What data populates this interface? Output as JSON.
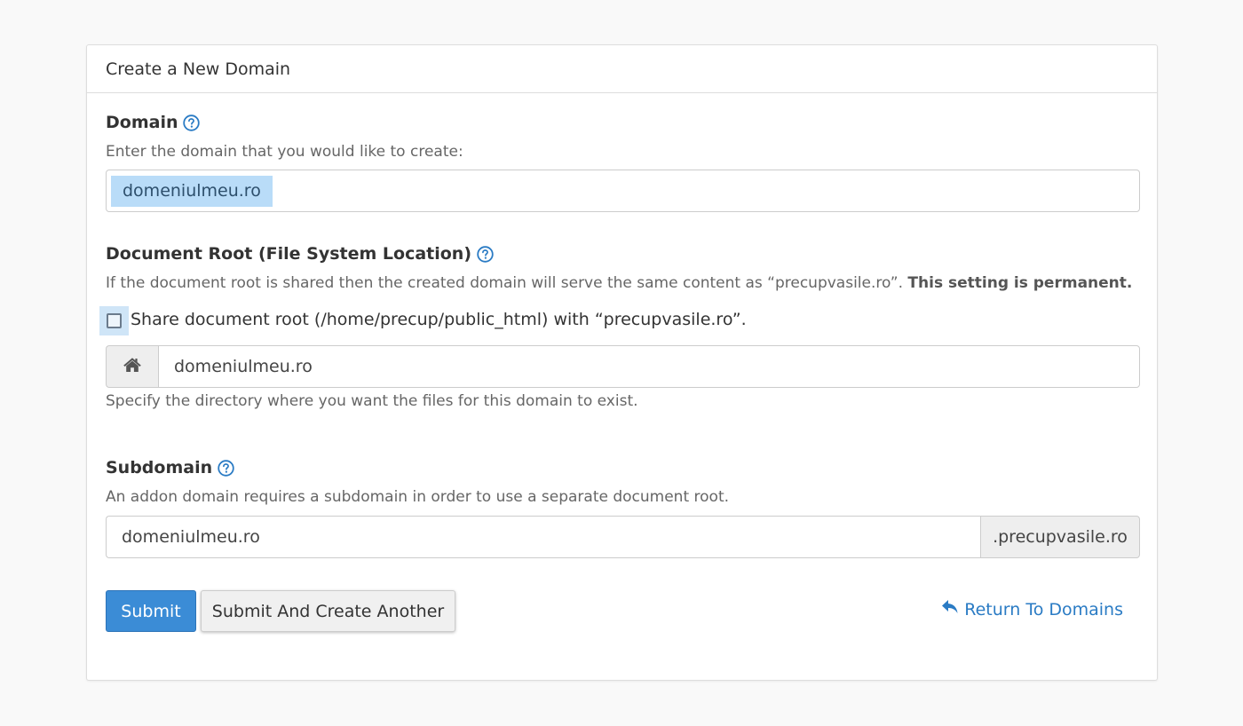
{
  "panel": {
    "title": "Create a New Domain"
  },
  "domain": {
    "label": "Domain",
    "description": "Enter the domain that you would like to create:",
    "value": "domeniulmeu.ro"
  },
  "document_root": {
    "label": "Document Root (File System Location)",
    "description": "If the document root is shared then the created domain will serve the same content as “precupvasile.ro”.",
    "description_bold": "This setting is permanent.",
    "share_checkbox_label": "Share document root (/home/precup/public_html) with “precupvasile.ro”.",
    "share_checked": false,
    "value": "domeniulmeu.ro",
    "help_text": "Specify the directory where you want the files for this domain to exist."
  },
  "subdomain": {
    "label": "Subdomain",
    "description": "An addon domain requires a subdomain in order to use a separate document root.",
    "value": "domeniulmeu.ro",
    "suffix": ".precupvasile.ro"
  },
  "actions": {
    "submit_label": "Submit",
    "submit_another_label": "Submit And Create Another",
    "return_label": "Return To Domains"
  },
  "colors": {
    "accent": "#3b8cd6",
    "link": "#2a7bc4",
    "selection": "#b9dcf8"
  },
  "icons": {
    "help": "question-circle-icon",
    "home": "home-icon",
    "return": "reply-arrow-icon"
  }
}
